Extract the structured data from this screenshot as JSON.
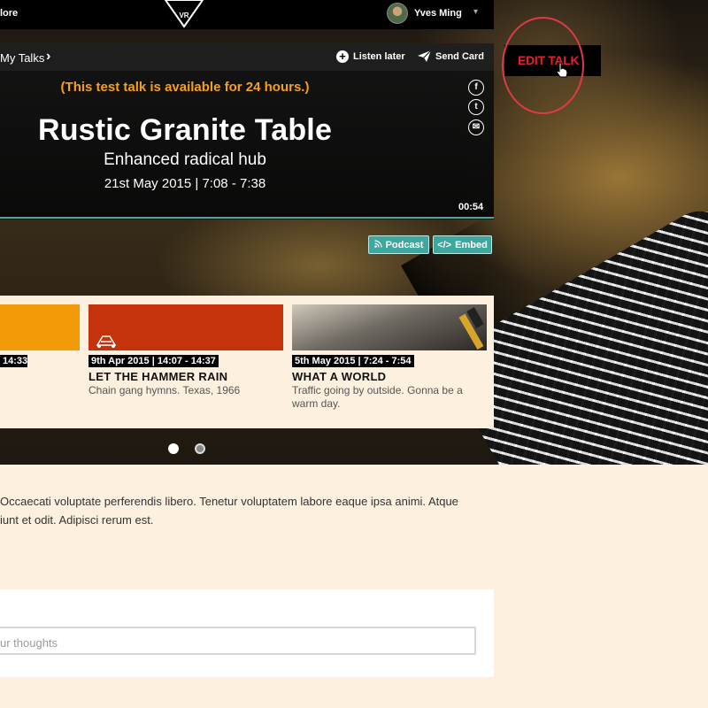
{
  "nav": {
    "explore": "lore",
    "logo_text": "VR",
    "user_name": "Yves Ming",
    "caret": "▾"
  },
  "player": {
    "breadcrumb": "My Talks",
    "breadcrumb_chevron": "›",
    "listen_later": "Listen later",
    "send_card": "Send Card",
    "availability": "(This test talk is available for 24 hours.)",
    "title": "Rustic Granite Table",
    "subtitle": "Enhanced radical hub",
    "date": "21st May 2015 | 7:08 - 7:38",
    "duration": "00:54",
    "social": [
      "f",
      "t",
      "✉"
    ]
  },
  "actions": {
    "podcast": "Podcast",
    "embed": "Embed",
    "edit_talk": "EDIT TALK"
  },
  "carousel": {
    "cards": [
      {
        "color": "#f29a08",
        "time": "14:33",
        "title": "",
        "desc": ""
      },
      {
        "color": "#c4330c",
        "date": "9th Apr 2015",
        "time": "14:07 - 14:37",
        "title": "LET THE HAMMER RAIN",
        "desc": "Chain gang hymns. Texas, 1966"
      },
      {
        "color": "#9a9386",
        "date": "5th May 2015",
        "time": "7:24 - 7:54",
        "title": "WHAT A WORLD",
        "desc": "Traffic going by outside. Gonna be a warm day."
      }
    ],
    "dots_active": 1
  },
  "description": {
    "line1": "Occaecati voluptate perferendis libero. Tenetur voluptatem labore eaque ipsa animi. Atque",
    "line2": "iunt et odit. Adipisci rerum est."
  },
  "comment": {
    "placeholder": "ur thoughts"
  },
  "colors": {
    "accent_teal": "#3fa89e",
    "availability_orange": "#f6a019",
    "edit_red": "#e5202e",
    "page_bg": "#fdf0de"
  }
}
